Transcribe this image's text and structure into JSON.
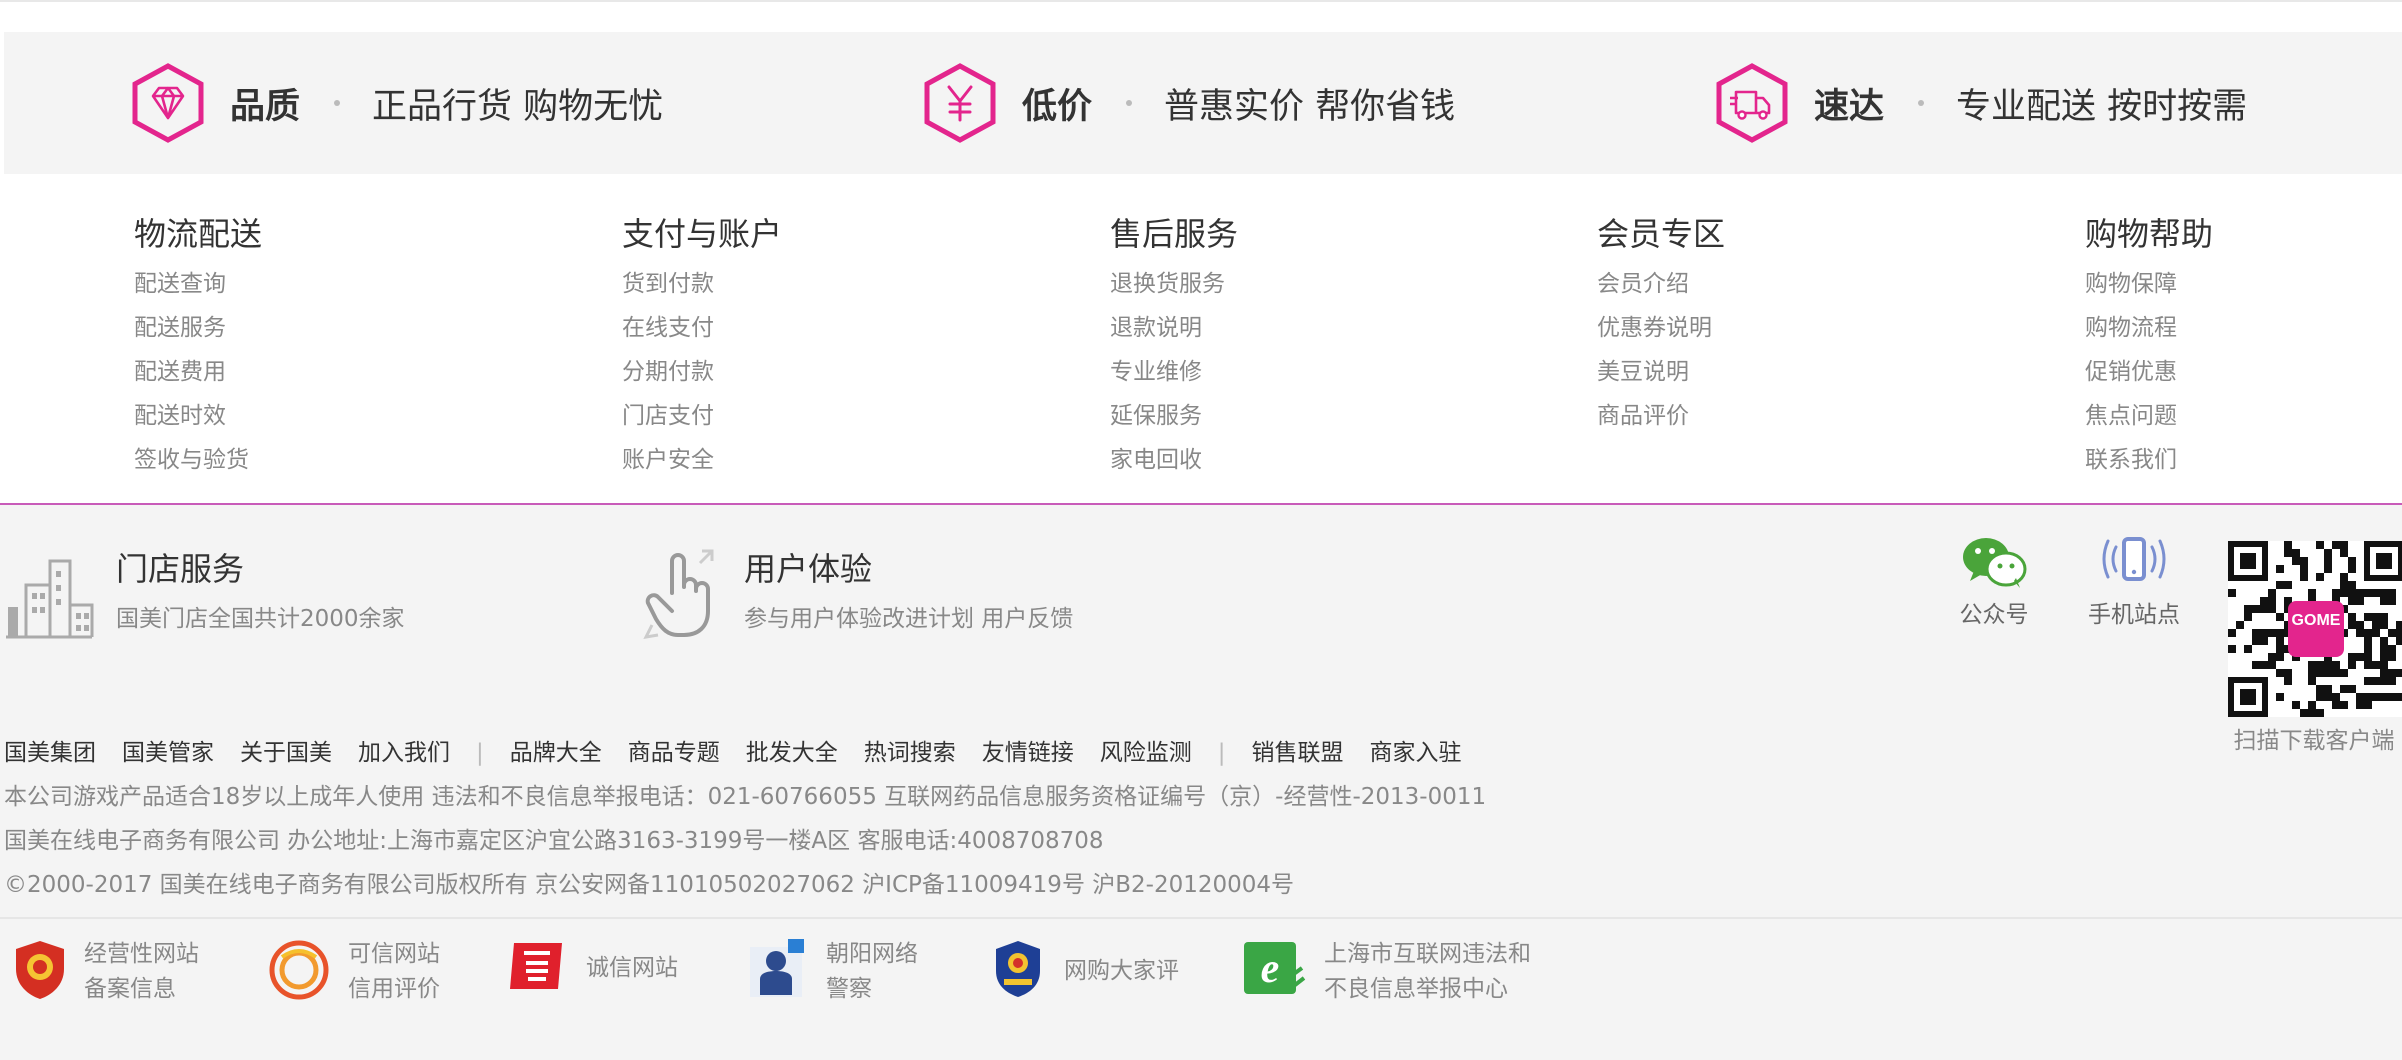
{
  "promises": [
    {
      "icon": "diamond-icon",
      "title": "品质",
      "desc": "正品行货 购物无忧"
    },
    {
      "icon": "yuan-icon",
      "title": "低价",
      "desc": "普惠实价 帮你省钱"
    },
    {
      "icon": "truck-icon",
      "title": "速达",
      "desc": "专业配送 按时按需"
    }
  ],
  "help_columns": [
    {
      "title": "物流配送",
      "links": [
        "配送查询",
        "配送服务",
        "配送费用",
        "配送时效",
        "签收与验货"
      ]
    },
    {
      "title": "支付与账户",
      "links": [
        "货到付款",
        "在线支付",
        "分期付款",
        "门店支付",
        "账户安全"
      ]
    },
    {
      "title": "售后服务",
      "links": [
        "退换货服务",
        "退款说明",
        "专业维修",
        "延保服务",
        "家电回收"
      ]
    },
    {
      "title": "会员专区",
      "links": [
        "会员介绍",
        "优惠券说明",
        "美豆说明",
        "商品评价"
      ]
    },
    {
      "title": "购物帮助",
      "links": [
        "购物保障",
        "购物流程",
        "促销优惠",
        "焦点问题",
        "联系我们"
      ]
    }
  ],
  "services": [
    {
      "icon": "buildings-icon",
      "title": "门店服务",
      "sub": "国美门店全国共计2000余家"
    },
    {
      "icon": "hand-pointer-icon",
      "title": "用户体验",
      "sub": "参与用户体验改进计划 用户反馈"
    }
  ],
  "social": [
    {
      "icon": "wechat-icon",
      "label": "公众号"
    },
    {
      "icon": "mobile-icon",
      "label": "手机站点"
    }
  ],
  "qr": {
    "label": "扫描下载客户端",
    "logo_text": "GOME"
  },
  "footer_links": {
    "group1": [
      "国美集团",
      "国美管家",
      "关于国美",
      "加入我们"
    ],
    "group2": [
      "品牌大全",
      "商品专题",
      "批发大全",
      "热词搜索",
      "友情链接",
      "风险监测"
    ],
    "group3": [
      "销售联盟",
      "商家入驻"
    ],
    "separator": "|"
  },
  "info_lines": [
    "本公司游戏产品适合18岁以上成年人使用  违法和不良信息举报电话：021-60766055  互联网药品信息服务资格证编号（京）-经营性-2013-0011",
    "国美在线电子商务有限公司  办公地址:上海市嘉定区沪宜公路3163-3199号一楼A区  客服电话:4008708708",
    "©2000-2017  国美在线电子商务有限公司版权所有  京公安网备11010502027062  沪ICP备11009419号  沪B2-20120004号"
  ],
  "badges": [
    {
      "icon": "police-shield-icon",
      "line1": "经营性网站",
      "line2": "备案信息"
    },
    {
      "icon": "credit-circle-icon",
      "line1": "可信网站",
      "line2": "信用评价"
    },
    {
      "icon": "xin-icon",
      "line1": "诚信网站",
      "line2": ""
    },
    {
      "icon": "cyber-police-icon",
      "line1": "朝阳网络",
      "line2": "警察"
    },
    {
      "icon": "emblem-icon",
      "line1": "网购大家评",
      "line2": ""
    },
    {
      "icon": "e-report-icon",
      "line1": "上海市互联网违法和",
      "line2": "不良信息举报中心"
    }
  ],
  "colors": {
    "accent": "#e3258d",
    "pink_line": "#c85bb9",
    "bg_gray": "#f4f4f4"
  }
}
